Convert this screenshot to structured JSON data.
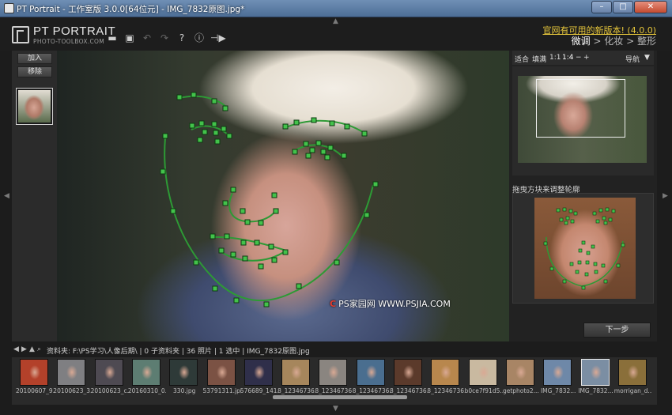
{
  "window": {
    "title": "PT Portrait - 工作室版 3.0.0[64位元] - IMG_7832原图.jpg*"
  },
  "app": {
    "logo_title": "PT PORTRAIT",
    "logo_subtitle": "PHOTO-TOOLBOX.COM"
  },
  "toolbar": {
    "icons": [
      "open-icon",
      "save-icon",
      "undo-icon",
      "redo-icon",
      "help-icon",
      "info-icon",
      "plugin-icon"
    ],
    "glyphs": {
      "open": "▬",
      "save": "▣",
      "undo": "↶",
      "redo": "↷",
      "help": "?",
      "info": "ⓘ",
      "plugin": "⊣▶"
    }
  },
  "update_link": "官网有可用的新版本! (4.0.0)",
  "mode_tabs": {
    "t1": "微调",
    "sep1": " > ",
    "t2": "化妆",
    "sep2": " > ",
    "t3": "整形"
  },
  "left": {
    "add": "加入",
    "remove": "移除"
  },
  "navigator": {
    "fit": "适合",
    "fill": "填满",
    "z1": "1:1",
    "z2": "1:4",
    "minus": "−",
    "plus": "+",
    "label": "导航",
    "caret": "▼"
  },
  "contour_label": "拖曳方块来调整轮廓",
  "next_button": "下一步",
  "watermark": {
    "mark": "C",
    "text": "PS家园网  WWW.PSJIA.COM"
  },
  "infobar": {
    "text": "资料夹: F:\\PS学习\\人像后期\\ | 0 子资料夹 | 36 照片 | 1 选中 | IMG_7832原图.jpg"
  },
  "filmstrip": [
    {
      "name": "20100607_9...",
      "color": "#b3412a"
    },
    {
      "name": "20100623_3...",
      "color": "#7f7f82"
    },
    {
      "name": "20100623_c...",
      "color": "#4e4a52"
    },
    {
      "name": "20160310_0...",
      "color": "#5d7d72"
    },
    {
      "name": "330.jpg",
      "color": "#2e3a38"
    },
    {
      "name": "53791311.jpg",
      "color": "#7b5244"
    },
    {
      "name": "576689_141...",
      "color": "#2f2f4a"
    },
    {
      "name": "8_12346736...",
      "color": "#a6865c"
    },
    {
      "name": "8_12346736...",
      "color": "#8a8580"
    },
    {
      "name": "8_12346736...",
      "color": "#4a6e8f"
    },
    {
      "name": "8_12346736...",
      "color": "#5b3a2b"
    },
    {
      "name": "8_12346736...",
      "color": "#b8874d"
    },
    {
      "name": "b0ce7f91d5...",
      "color": "#c9b9a0"
    },
    {
      "name": "getphoto2...",
      "color": "#a88565"
    },
    {
      "name": "IMG_7832...",
      "color": "#6e88a8"
    },
    {
      "name": "IMG_7832...",
      "color": "#7b8ea3",
      "selected": true
    },
    {
      "name": "morrigan_d...",
      "color": "#8a6f3a"
    }
  ]
}
